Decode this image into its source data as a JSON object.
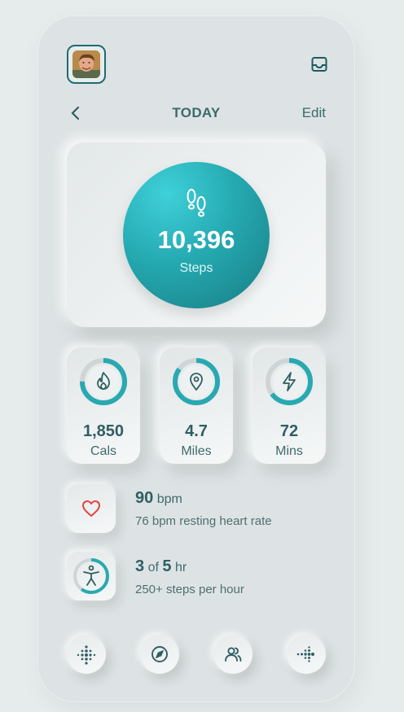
{
  "header": {
    "title": "TODAY",
    "edit_label": "Edit"
  },
  "hero": {
    "value": "10,396",
    "unit": "Steps"
  },
  "stats": [
    {
      "value": "1,850",
      "label": "Cals",
      "icon": "flame-icon",
      "progress": 0.75
    },
    {
      "value": "4.7",
      "label": "Miles",
      "icon": "location-pin-icon",
      "progress": 0.85
    },
    {
      "value": "72",
      "label": "Mins",
      "icon": "lightning-icon",
      "progress": 0.65
    }
  ],
  "heart": {
    "value": "90",
    "unit": "bpm",
    "detail": "76 bpm resting heart rate",
    "icon": "heart-icon"
  },
  "activity": {
    "value": "3",
    "of": "of",
    "target": "5",
    "unit": "hr",
    "detail": "250+ steps per hour",
    "icon": "person-activity-icon",
    "progress": 0.6
  },
  "nav": [
    "dots-grid-icon",
    "compass-icon",
    "friends-icon",
    "dots-arrow-icon"
  ],
  "colors": {
    "accent": "#28a9b1",
    "accent_dark": "#1a7c83",
    "heart": "#e0433f",
    "text": "#2f5f63"
  }
}
